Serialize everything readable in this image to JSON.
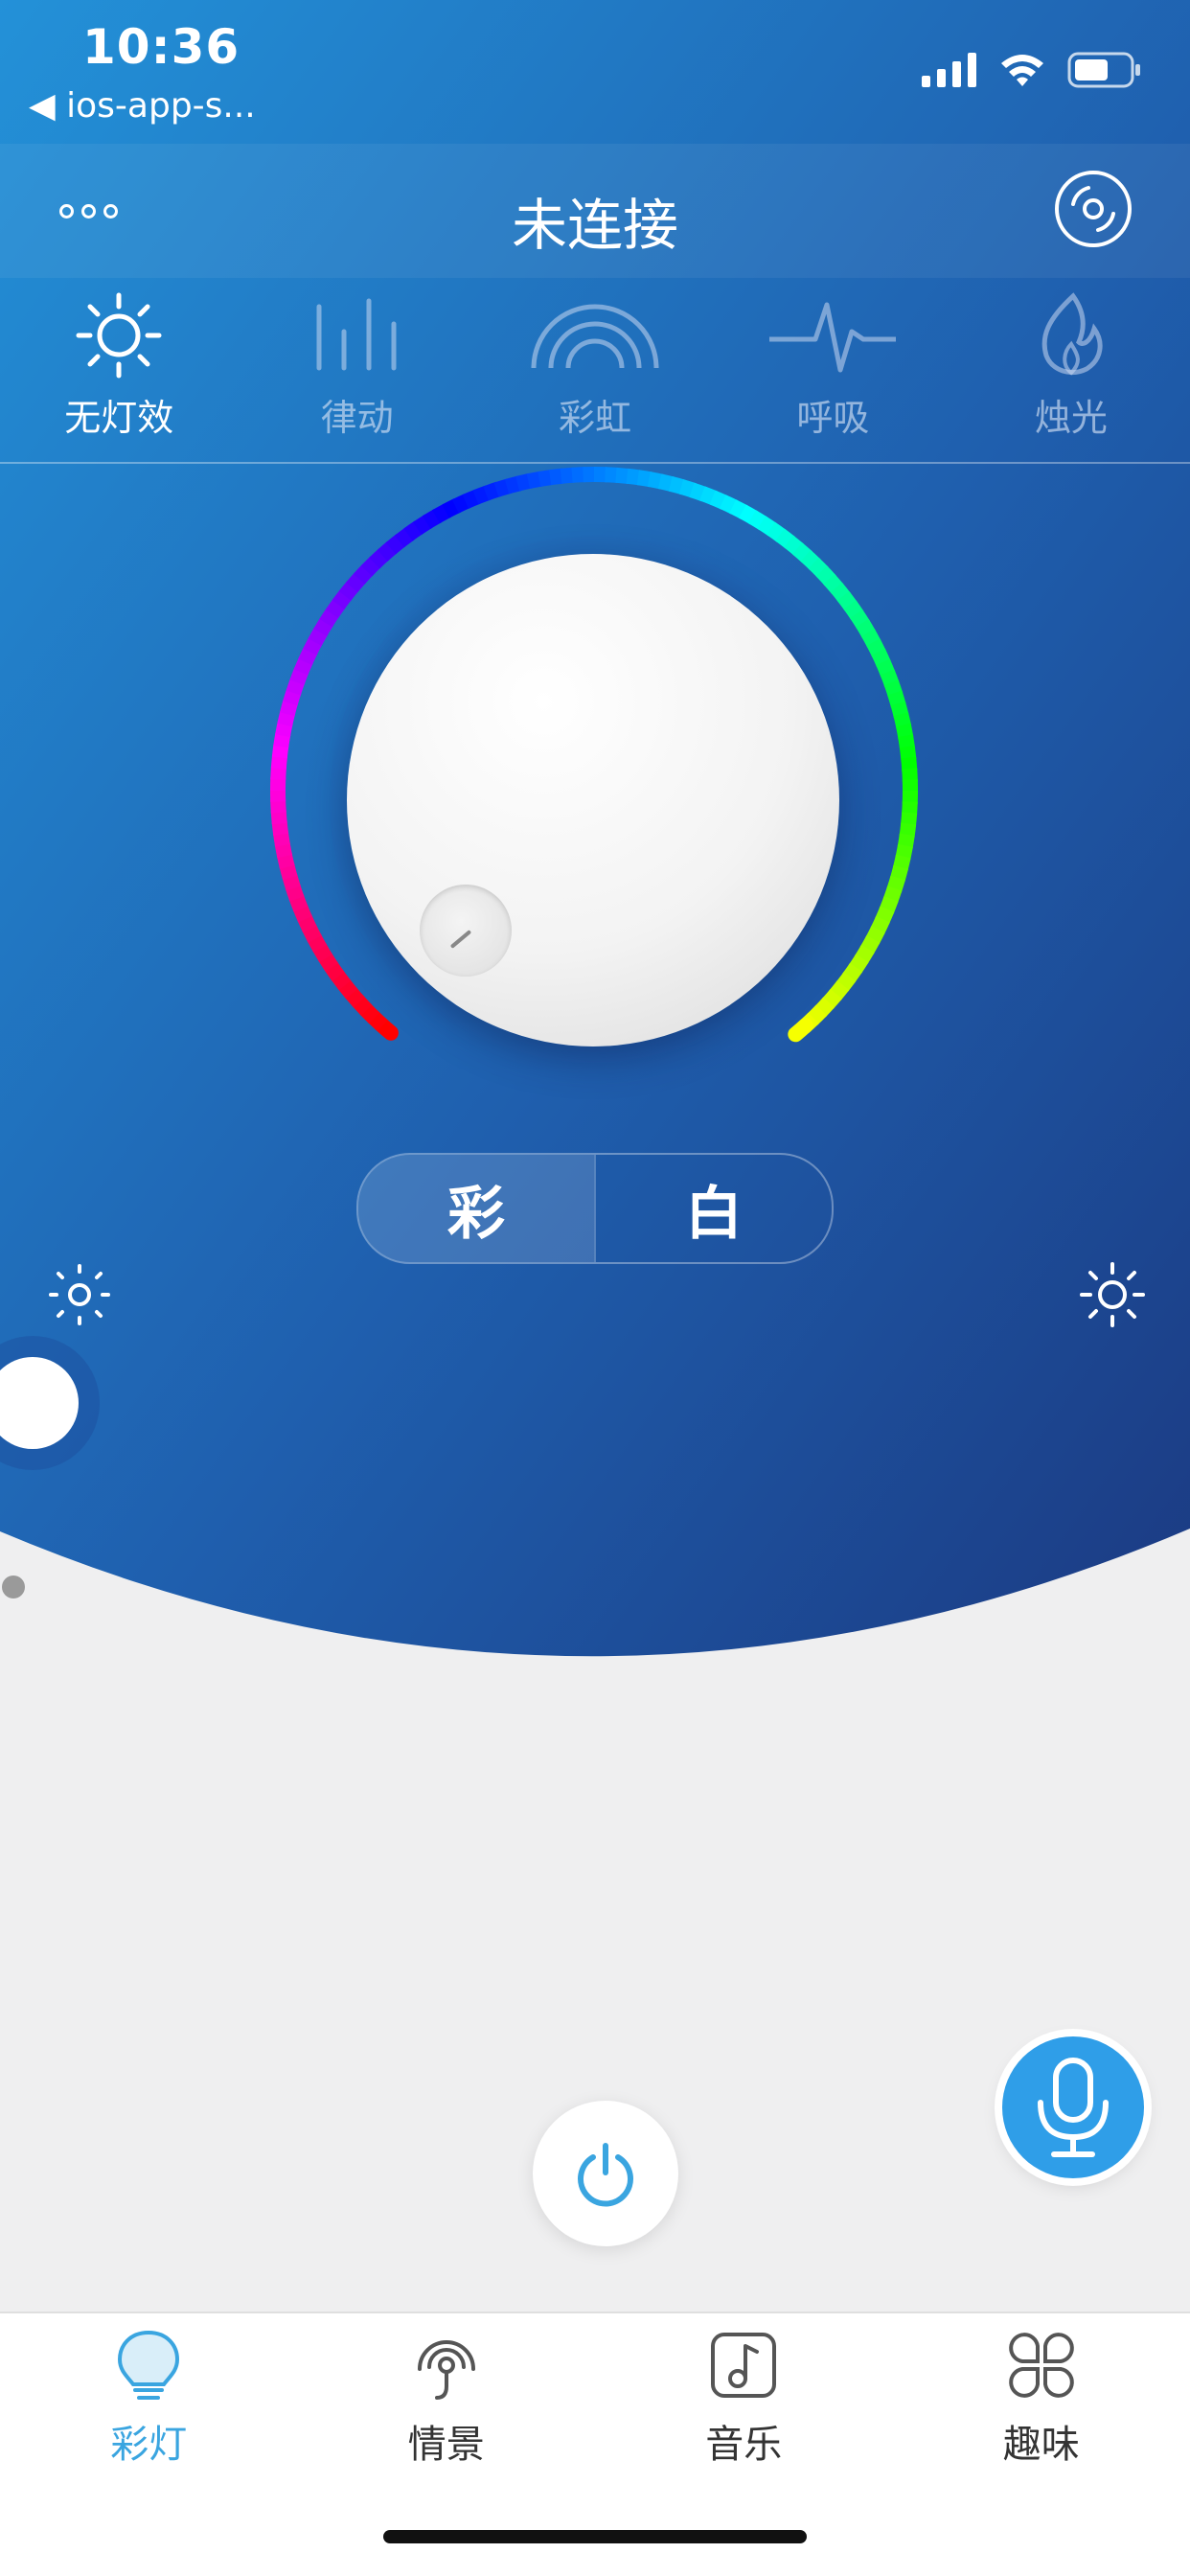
{
  "status_bar": {
    "time": "10:36",
    "back_label": "◀ ios-app-s..."
  },
  "header": {
    "title": "未连接",
    "more_icon": "more-dots-icon",
    "disc_icon": "disc-icon"
  },
  "effects": [
    {
      "label": "无灯效",
      "icon": "sun-icon",
      "active": true
    },
    {
      "label": "律动",
      "icon": "bars-icon",
      "active": false
    },
    {
      "label": "彩虹",
      "icon": "rainbow-icon",
      "active": false
    },
    {
      "label": "呼吸",
      "icon": "pulse-icon",
      "active": false
    },
    {
      "label": "烛光",
      "icon": "flame-icon",
      "active": false
    }
  ],
  "mode_switch": {
    "color_label": "彩",
    "white_label": "白",
    "selected": "彩"
  },
  "brightness": {
    "level": 0
  },
  "bottom_nav": [
    {
      "label": "彩灯",
      "icon": "bulb-icon",
      "active": true
    },
    {
      "label": "情景",
      "icon": "scene-icon",
      "active": false
    },
    {
      "label": "音乐",
      "icon": "music-note-icon",
      "active": false
    },
    {
      "label": "趣味",
      "icon": "four-petal-icon",
      "active": false
    }
  ],
  "colors": {
    "accent": "#3aa5e0",
    "top_gradient_start": "#2391d8",
    "top_gradient_end": "#1b3a82",
    "background": "#efeff0",
    "mic_button": "#2f9ee8"
  }
}
